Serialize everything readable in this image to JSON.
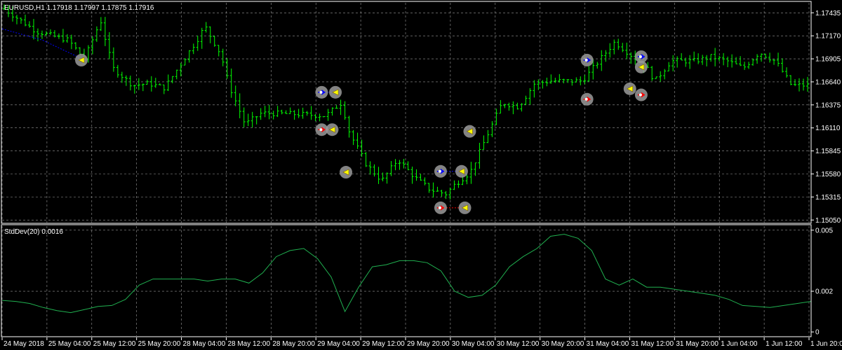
{
  "window": {
    "symbol_header": "EURUSD,H1  1.17918 1.17997 1.17875 1.17916",
    "indicator_header": "StdDev(20) 0.0016"
  },
  "colors": {
    "background": "#000000",
    "frame": "#ffffff",
    "grid": "#9a9a9a",
    "bars": "#00ff00",
    "moving_average": "#0000ff",
    "stddev_line": "#20b050",
    "trade_buy": "#0000ff",
    "trade_sell": "#ff0000",
    "trade_marker_ring": "#9a9a9a",
    "trade_marker_fill": "#ffff00"
  },
  "chart_data": [
    {
      "type": "ohlc",
      "series_name": "EURUSD,H1",
      "quote": {
        "open": 1.17918,
        "high": 1.17997,
        "low": 1.17875,
        "close": 1.17916
      },
      "y_ticks": [
        "1.17435",
        "1.17170",
        "1.16905",
        "1.16640",
        "1.16375",
        "1.16110",
        "1.15845",
        "1.15580",
        "1.15315",
        "1.15050"
      ],
      "ylim": [
        1.1502,
        1.1755
      ],
      "x_ticks": [
        "24 May 2018",
        "25 May 04:00",
        "25 May 12:00",
        "25 May 20:00",
        "28 May 04:00",
        "28 May 12:00",
        "28 May 20:00",
        "29 May 04:00",
        "29 May 12:00",
        "29 May 20:00",
        "30 May 04:00",
        "30 May 12:00",
        "30 May 20:00",
        "31 May 04:00",
        "31 May 12:00",
        "31 May 20:00",
        "1 Jun 04:00",
        "1 Jun 12:00",
        "1 Jun 20:00"
      ],
      "close_path": [
        [
          0,
          1.1748
        ],
        [
          0.04,
          1.1722
        ],
        [
          0.08,
          1.1712
        ],
        [
          0.1,
          1.169
        ],
        [
          0.12,
          1.1735
        ],
        [
          0.135,
          1.168
        ],
        [
          0.16,
          1.166
        ],
        [
          0.18,
          1.1662
        ],
        [
          0.2,
          1.1657
        ],
        [
          0.22,
          1.1685
        ],
        [
          0.24,
          1.1712
        ],
        [
          0.25,
          1.1728
        ],
        [
          0.27,
          1.1695
        ],
        [
          0.28,
          1.166
        ],
        [
          0.3,
          1.1615
        ],
        [
          0.32,
          1.1628
        ],
        [
          0.36,
          1.1627
        ],
        [
          0.4,
          1.1625
        ],
        [
          0.42,
          1.164
        ],
        [
          0.43,
          1.1605
        ],
        [
          0.45,
          1.157
        ],
        [
          0.47,
          1.155
        ],
        [
          0.49,
          1.1575
        ],
        [
          0.51,
          1.1555
        ],
        [
          0.53,
          1.154
        ],
        [
          0.55,
          1.1535
        ],
        [
          0.56,
          1.1545
        ],
        [
          0.58,
          1.156
        ],
        [
          0.6,
          1.16
        ],
        [
          0.62,
          1.164
        ],
        [
          0.64,
          1.1635
        ],
        [
          0.66,
          1.1662
        ],
        [
          0.68,
          1.1665
        ],
        [
          0.72,
          1.1665
        ],
        [
          0.74,
          1.1688
        ],
        [
          0.76,
          1.171
        ],
        [
          0.78,
          1.1695
        ],
        [
          0.8,
          1.168
        ],
        [
          0.81,
          1.1665
        ],
        [
          0.83,
          1.1688
        ],
        [
          0.86,
          1.1688
        ],
        [
          0.88,
          1.1693
        ],
        [
          0.9,
          1.1688
        ],
        [
          0.92,
          1.168
        ],
        [
          0.94,
          1.1698
        ],
        [
          0.96,
          1.1688
        ],
        [
          0.98,
          1.166
        ],
        [
          1,
          1.166
        ]
      ],
      "moving_average_path": [
        [
          0,
          1.1725
        ],
        [
          0.05,
          1.1712
        ],
        [
          0.1,
          1.169
        ]
      ],
      "trades": [
        {
          "x": 0.098,
          "y": 1.1689,
          "kind": "exit"
        },
        {
          "x": 0.395,
          "y": 1.1652,
          "kind": "buy",
          "pair_x": 0.412
        },
        {
          "x": 0.395,
          "y": 1.1609,
          "kind": "sell",
          "pair_x": 0.408
        },
        {
          "x": 0.425,
          "y": 1.156,
          "kind": "exit"
        },
        {
          "x": 0.542,
          "y": 1.1561,
          "kind": "buy",
          "pair_x": 0.568
        },
        {
          "x": 0.542,
          "y": 1.1519,
          "kind": "sell",
          "pair_x": 0.572
        },
        {
          "x": 0.578,
          "y": 1.1607,
          "kind": "exit"
        },
        {
          "x": 0.723,
          "y": 1.1689,
          "kind": "buy"
        },
        {
          "x": 0.723,
          "y": 1.1644,
          "kind": "sell"
        },
        {
          "x": 0.776,
          "y": 1.1656,
          "kind": "exit"
        },
        {
          "x": 0.79,
          "y": 1.1693,
          "kind": "buy"
        },
        {
          "x": 0.79,
          "y": 1.1681,
          "kind": "exit"
        },
        {
          "x": 0.79,
          "y": 1.1649,
          "kind": "sell"
        }
      ]
    },
    {
      "type": "line",
      "series_name": "StdDev(20)",
      "last_value": 0.0016,
      "y_ticks": [
        "0.005",
        "0.002",
        "0"
      ],
      "ylim": [
        -0.0002,
        0.0052
      ],
      "values": [
        0.00155,
        0.0015,
        0.0014,
        0.0012,
        0.00105,
        0.00095,
        0.0011,
        0.00125,
        0.0013,
        0.0016,
        0.0023,
        0.0026,
        0.0026,
        0.0026,
        0.0026,
        0.0025,
        0.0026,
        0.0026,
        0.0024,
        0.0029,
        0.0037,
        0.004,
        0.0041,
        0.0036,
        0.0027,
        0.001,
        0.0022,
        0.0032,
        0.0033,
        0.0035,
        0.0035,
        0.0034,
        0.003,
        0.002,
        0.0017,
        0.0018,
        0.0023,
        0.0032,
        0.0037,
        0.0041,
        0.0047,
        0.0048,
        0.0046,
        0.004,
        0.0026,
        0.0023,
        0.0026,
        0.0022,
        0.0022,
        0.0021,
        0.002,
        0.0019,
        0.0018,
        0.0016,
        0.0013,
        0.00125,
        0.0012,
        0.0013,
        0.0014,
        0.0015
      ]
    }
  ]
}
